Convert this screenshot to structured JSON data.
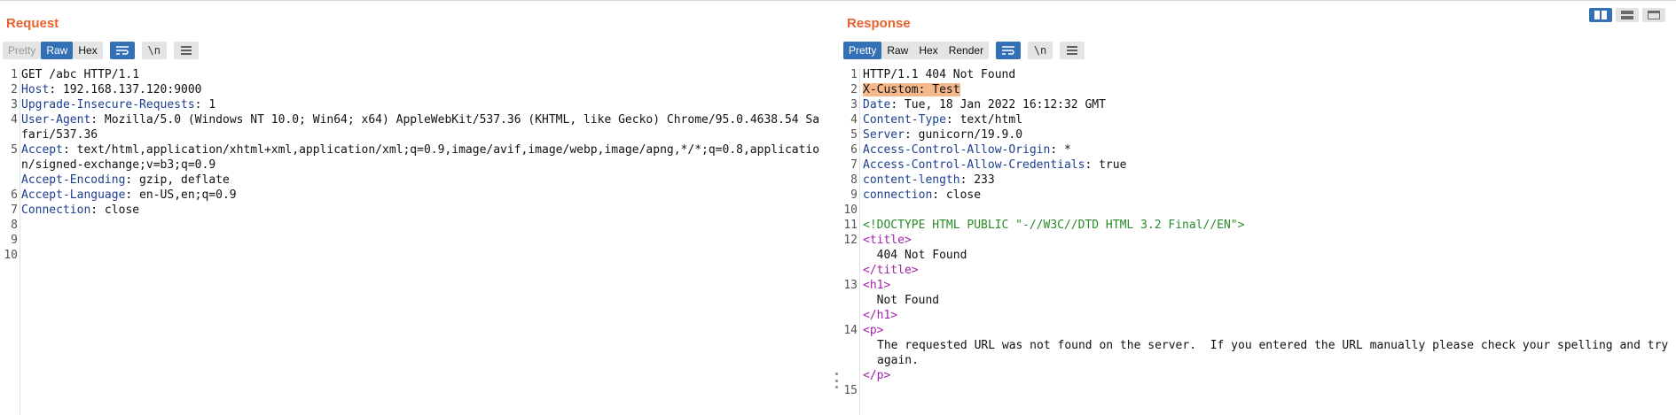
{
  "request": {
    "title": "Request",
    "tabs": [
      {
        "label": "Pretty",
        "state": "disabled"
      },
      {
        "label": "Raw",
        "state": "active"
      },
      {
        "label": "Hex",
        "state": "normal"
      }
    ],
    "icons": [
      "word-wrap-icon",
      "newline-icon",
      "menu-icon"
    ],
    "newline_label": "\\n",
    "line_numbers": [
      "1",
      "2",
      "3",
      "4",
      "5",
      "6",
      "7",
      "8",
      "9",
      "10"
    ],
    "lines": [
      {
        "value": "GET /abc HTTP/1.1"
      },
      {
        "name": "Host",
        "value": " 192.168.137.120:9000"
      },
      {
        "name": "Upgrade-Insecure-Requests",
        "value": " 1"
      },
      {
        "name": "User-Agent",
        "value": " Mozilla/5.0 (Windows NT 10.0; Win64; x64) AppleWebKit/537.36 (KHTML, like Gecko) Chrome/95.0.4638.54 Safari/537.36"
      },
      {
        "name": "Accept",
        "value": " text/html,application/xhtml+xml,application/xml;q=0.9,image/avif,image/webp,image/apng,*/*;q=0.8,application/signed-exchange;v=b3;q=0.9"
      },
      {
        "name": "Accept-Encoding",
        "value": " gzip, deflate"
      },
      {
        "name": "Accept-Language",
        "value": " en-US,en;q=0.9"
      },
      {
        "name": "Connection",
        "value": " close"
      },
      {
        "value": ""
      },
      {
        "value": ""
      }
    ]
  },
  "response": {
    "title": "Response",
    "tabs": [
      {
        "label": "Pretty",
        "state": "active"
      },
      {
        "label": "Raw",
        "state": "normal"
      },
      {
        "label": "Hex",
        "state": "normal"
      },
      {
        "label": "Render",
        "state": "normal"
      }
    ],
    "icons": [
      "word-wrap-icon",
      "newline-icon",
      "menu-icon"
    ],
    "newline_label": "\\n",
    "line_numbers": [
      "1",
      "2",
      "3",
      "4",
      "5",
      "6",
      "7",
      "8",
      "9",
      "10",
      "11",
      "12",
      "13",
      "14",
      "15"
    ],
    "status_line": "HTTP/1.1 404 Not Found",
    "highlighted_header": "X-Custom: Test",
    "headers": [
      {
        "name": "Date",
        "value": " Tue, 18 Jan 2022 16:12:32 GMT"
      },
      {
        "name": "Content-Type",
        "value": " text/html"
      },
      {
        "name": "Server",
        "value": " gunicorn/19.9.0"
      },
      {
        "name": "Access-Control-Allow-Origin",
        "value": " *"
      },
      {
        "name": "Access-Control-Allow-Credentials",
        "value": " true"
      },
      {
        "name": "content-length",
        "value": " 233"
      },
      {
        "name": "connection",
        "value": " close"
      }
    ],
    "doctype": "<!DOCTYPE HTML PUBLIC \"-//W3C//DTD HTML 3.2 Final//EN\">",
    "title_open": "<title>",
    "title_text": "404 Not Found",
    "title_close": "</title>",
    "h1_open": "<h1>",
    "h1_text": "Not Found",
    "h1_close": "</h1>",
    "p_open": "<p>",
    "p_text": "The requested URL was not found on the server.  If you entered the URL manually please check your spelling and try again.",
    "p_close": "</p>"
  },
  "layout_modes": [
    {
      "icon": "split-horizontal-icon",
      "active": true
    },
    {
      "icon": "split-vertical-icon",
      "active": false
    },
    {
      "icon": "tabs-icon",
      "active": false
    }
  ],
  "accent_color": "#e8622c",
  "active_color": "#3470b5"
}
